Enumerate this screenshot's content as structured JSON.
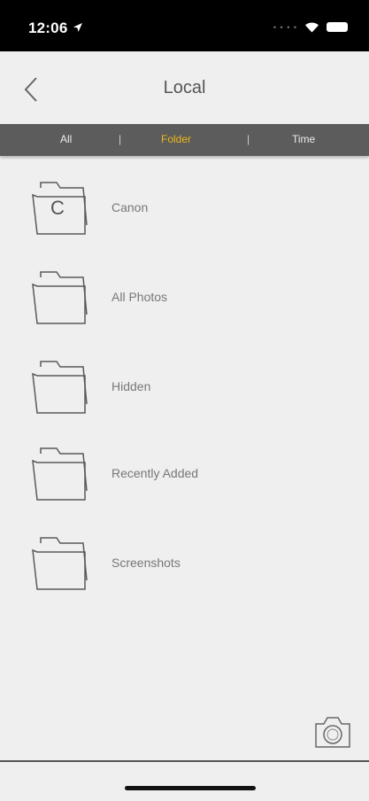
{
  "status_bar": {
    "time": "12:06",
    "icons": [
      "location-arrow-icon",
      "wifi-icon",
      "battery-icon"
    ]
  },
  "header": {
    "title": "Local",
    "back_icon": "chevron-left-icon"
  },
  "tabs": [
    {
      "label": "All",
      "active": false
    },
    {
      "label": "Folder",
      "active": true
    },
    {
      "label": "Time",
      "active": false
    }
  ],
  "tab_separator": "|",
  "colors": {
    "active_tab": "#f0b81a",
    "tab_bar": "#5c5c5c",
    "background": "#efefef"
  },
  "folders": [
    {
      "name": "Canon",
      "letter": "C"
    },
    {
      "name": "All Photos",
      "letter": ""
    },
    {
      "name": "Hidden",
      "letter": ""
    },
    {
      "name": "Recently Added",
      "letter": ""
    },
    {
      "name": "Screenshots",
      "letter": ""
    }
  ],
  "footer": {
    "camera_icon": "camera-icon"
  }
}
